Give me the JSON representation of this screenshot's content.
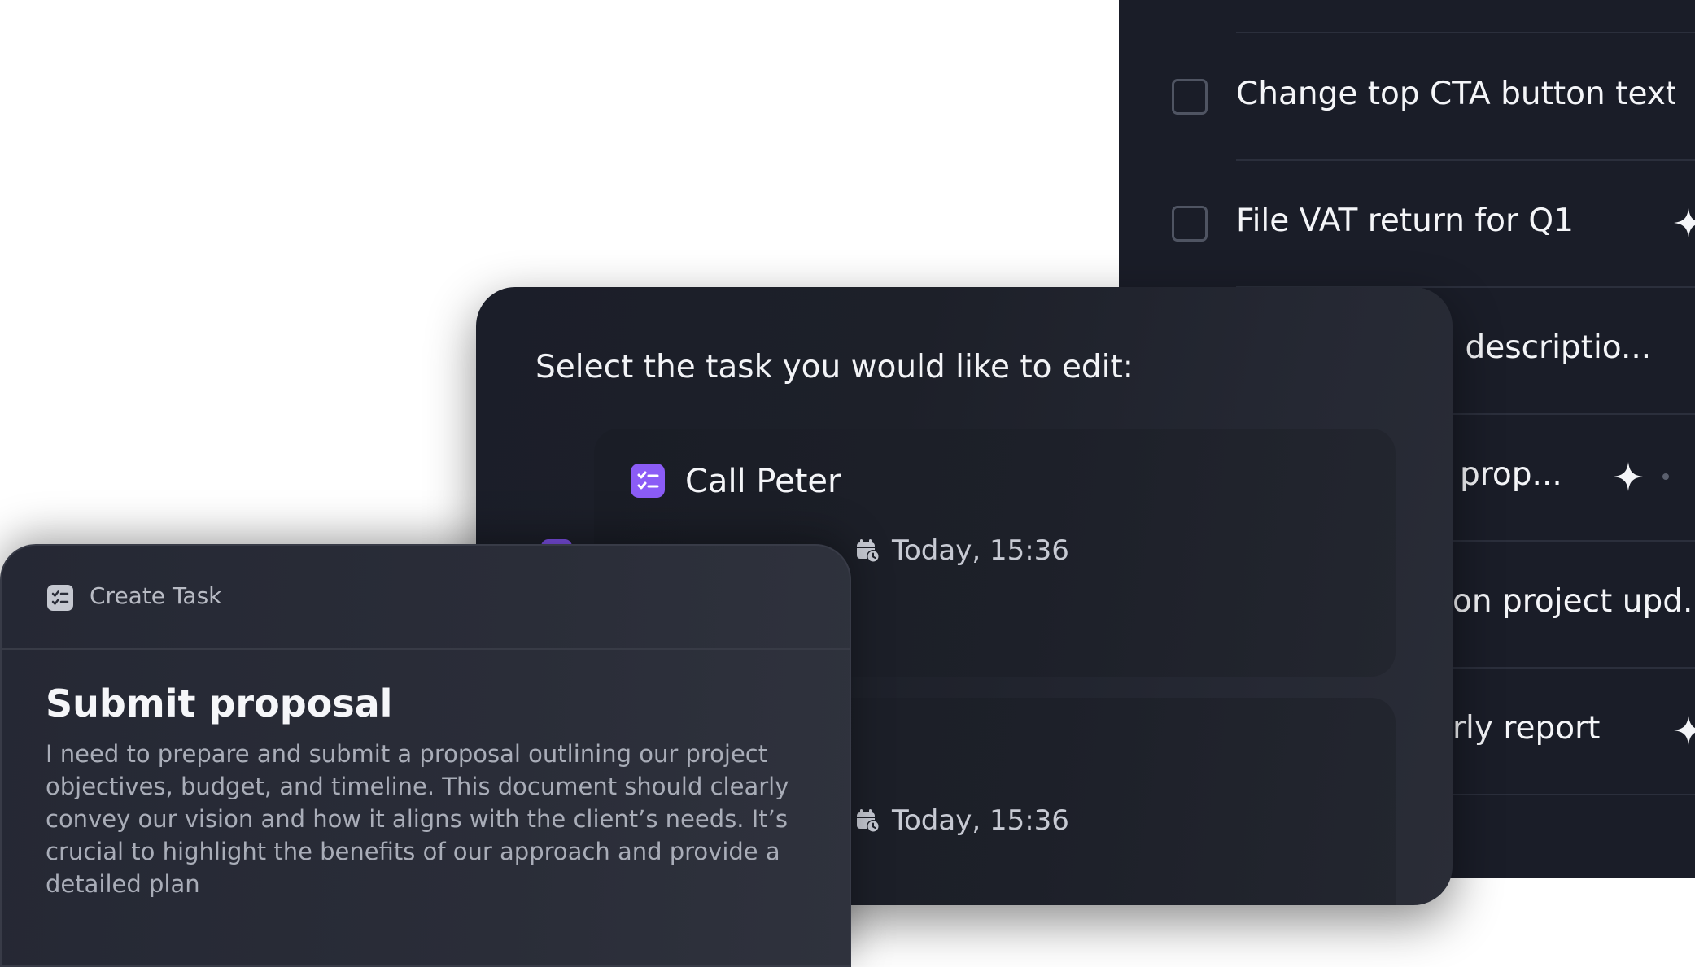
{
  "task_list": {
    "items": [
      {
        "label": "Change top CTA button text t...",
        "sparkle": false
      },
      {
        "label": "File VAT return for Q1",
        "sparkle": true
      },
      {
        "label": ": descriptio...",
        "sparkle": false
      },
      {
        "label": "prop...",
        "sparkle": true
      },
      {
        "label": "on project upd...",
        "sparkle": false
      },
      {
        "label": "rly report",
        "sparkle": true
      }
    ]
  },
  "select_dialog": {
    "title": "Select the task you would like to edit:",
    "cards": [
      {
        "title": "Call Peter",
        "date_label": "Today,  15:36",
        "icon": "task-list-icon"
      },
      {
        "title": "",
        "date_label": "Today,  15:36",
        "icon": "task-list-icon"
      }
    ]
  },
  "create_task": {
    "header_label": "Create Task",
    "header_icon": "task-list-icon",
    "title": "Submit proposal",
    "body": "I need to prepare and submit a proposal outlining our project objectives, budget, and timeline. This document should clearly convey our vision and how it aligns with the client’s needs. It’s crucial to highlight the benefits of our approach and provide a detailed plan"
  },
  "colors": {
    "accent": "#8b5cf6",
    "panel_bg": "#1a1d28",
    "dialog_bg": "#1d2029",
    "card_bg": "#1d2029"
  }
}
